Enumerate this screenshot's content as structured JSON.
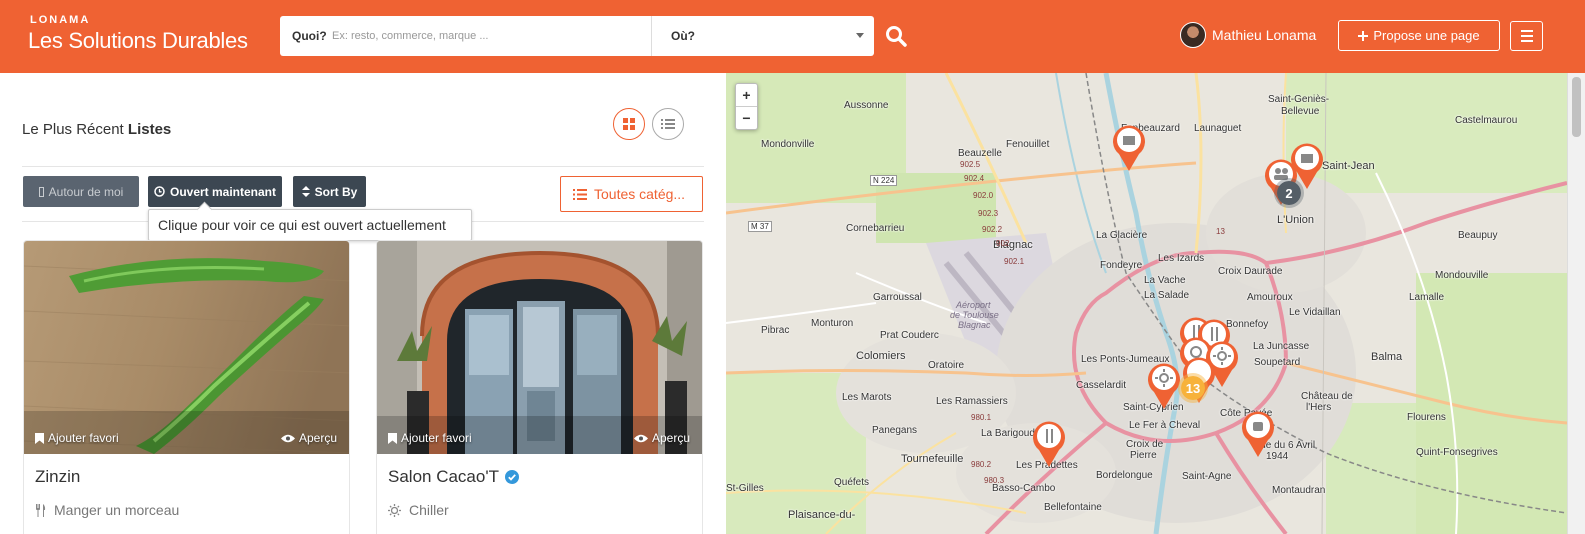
{
  "header": {
    "brand_small": "LONAMA",
    "brand_main": "Les Solutions Durables",
    "search": {
      "what_label": "Quoi?",
      "what_placeholder": "Ex: resto, commerce, marque ...",
      "where_label": "Où?"
    },
    "user_name": "Mathieu Lonama",
    "propose_label": "Propose une page",
    "icons": [
      "search-icon",
      "plus-icon",
      "hamburger-menu-icon",
      "avatar"
    ]
  },
  "listing": {
    "title_prefix": "Le Plus Récent",
    "title_bold": "Listes",
    "filters": {
      "near_me": "Autour de moi",
      "open_now": "Ouvert maintenant",
      "sort_by": "Sort By",
      "categories": "Toutes catég..."
    },
    "tooltip": "Clique pour voir ce qui est ouvert actuellement",
    "cards": [
      {
        "title": "Zinzin",
        "category": "Manger un morceau",
        "favorite": "Ajouter favori",
        "preview": "Aperçu",
        "verified": false
      },
      {
        "title": "Salon Cacao'T",
        "category": "Chiller",
        "favorite": "Ajouter favori",
        "preview": "Aperçu",
        "verified": true
      }
    ]
  },
  "map": {
    "zoom_in": "+",
    "zoom_out": "−",
    "clusters": {
      "top": "2",
      "center": "13"
    },
    "labels": {
      "aussonne": "Aussonne",
      "fenouillet": "Fenouillet",
      "fonbeauzard": "Fonbeauzard",
      "launaguet": "Launaguet",
      "st_genies": "Saint-Geniès-",
      "bellevue": "Bellevue",
      "castelmaurou": "Castelmaurou",
      "mondonville": "Mondonville",
      "beauzelle": "Beauzelle",
      "st_jean": "Saint-Jean",
      "lunion": "L'Union",
      "cornebarrieu": "Cornebarrieu",
      "blagnac": "Blagnac",
      "la_glaciere": "La Glacière",
      "les_izards": "Les Izards",
      "beaupuy": "Beaupuy",
      "fondeyre": "Fondeyre",
      "croix_daurade": "Croix Daurade",
      "la_vache": "La Vache",
      "mondouville": "Mondouville",
      "garroussal": "Garroussal",
      "la_salade": "La Salade",
      "amouroux": "Amouroux",
      "aeroport_1": "Aéroport",
      "aeroport_2": "de Toulouse",
      "aeroport_3": "Blagnac",
      "le_vidaillan": "Le Vidaillan",
      "lamalle": "Lamalle",
      "pibrac": "Pibrac",
      "monturon": "Monturon",
      "prat_couderc": "Prat Couderc",
      "bonnefoy": "Bonnefoy",
      "la_juncasse": "La Juncasse",
      "colomiers": "Colomiers",
      "oratoire": "Oratoire",
      "les_ponts_jumeaux": "Les Ponts-Jumeaux",
      "soupetard": "Soupetard",
      "balma": "Balma",
      "casselardit": "Casselardit",
      "chateau_1": "Château de",
      "chateau_2": "l'Hers",
      "les_marots": "Les Marots",
      "les_ramassiers": "Les Ramassiers",
      "st_cyprien": "Saint-Cyprien",
      "cote_pavee": "Côte Pavée",
      "panegans": "Panegans",
      "le_fer": "Le Fer à Cheval",
      "flourens": "Flourens",
      "tournefeuille": "Tournefeuille",
      "la_barigoude": "La Barigoude",
      "les_pradettes": "Les Pradettes",
      "croix_de": "Croix de",
      "pierre": "Pierre",
      "rue_1": "Rue du 6 Avril",
      "rue_2": "1944",
      "quint": "Quint-Fonsegrives",
      "st_gilles": "St-Gilles",
      "quefets": "Quéfets",
      "basso_cambo": "Basso-Cambo",
      "bordelongue": "Bordelongue",
      "st_agne": "Saint-Agne",
      "montaudran": "Montaudran",
      "plaisance": "Plaisance-du-",
      "bellefontaine": "Bellefontaine"
    },
    "road_shields": {
      "n224": "N 224",
      "m37": "M 37"
    },
    "road_numbers": [
      "902.5",
      "902.4",
      "902.3",
      "902.2",
      "902.1",
      "980.1",
      "980.2",
      "980.3",
      "902.0",
      "902",
      "13"
    ]
  },
  "colors": {
    "brand": "#ef6233",
    "dark_button": "#3c4752",
    "cluster_grey": "#545e67",
    "cluster_yellow": "#f7b23b",
    "verified": "#3498db"
  }
}
